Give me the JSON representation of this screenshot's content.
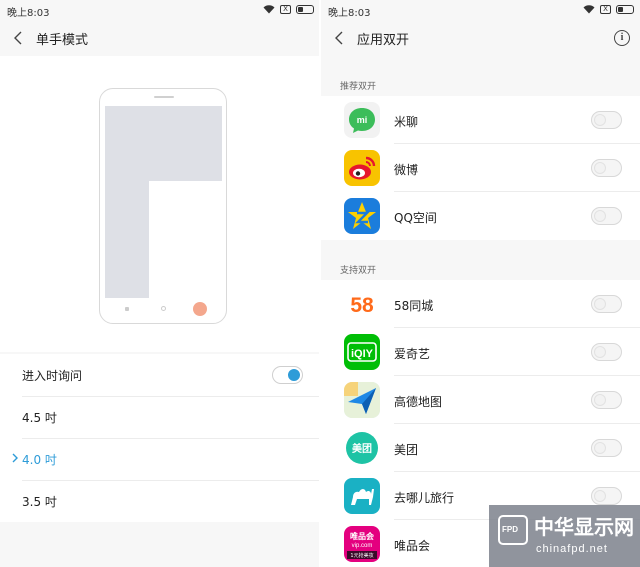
{
  "left": {
    "status": {
      "time": "晚上8:03",
      "sim_label": "X"
    },
    "header": {
      "title": "单手模式"
    },
    "enter_prompt": {
      "label": "进入时询问",
      "enabled": true
    },
    "sizes": [
      {
        "label": "4.5 吋",
        "selected": false
      },
      {
        "label": "4.0 吋",
        "selected": true
      },
      {
        "label": "3.5 吋",
        "selected": false
      }
    ]
  },
  "right": {
    "status": {
      "time": "晚上8:03",
      "sim_label": "X"
    },
    "header": {
      "title": "应用双开",
      "info_icon": "i"
    },
    "recommended": {
      "label": "推荐双开",
      "apps": [
        {
          "name": "米聊",
          "icon": "miliao-icon",
          "icon_text": "mi",
          "enabled": false
        },
        {
          "name": "微博",
          "icon": "weibo-icon",
          "enabled": false
        },
        {
          "name": "QQ空间",
          "icon": "qzone-icon",
          "enabled": false
        }
      ]
    },
    "supported": {
      "label": "支持双开",
      "apps": [
        {
          "name": "58同城",
          "icon": "58-icon",
          "icon_text": "58",
          "enabled": false
        },
        {
          "name": "爱奇艺",
          "icon": "iqiyi-icon",
          "icon_text": "iQIY",
          "enabled": false
        },
        {
          "name": "高德地图",
          "icon": "amap-icon",
          "enabled": false
        },
        {
          "name": "美团",
          "icon": "meituan-icon",
          "icon_text": "美团",
          "enabled": false
        },
        {
          "name": "去哪儿旅行",
          "icon": "qunar-icon",
          "enabled": false
        },
        {
          "name": "唯品会",
          "icon": "vip-icon",
          "icon_text": [
            "唯品会",
            "vip.com",
            "1元抢美妆"
          ],
          "enabled": false
        }
      ]
    }
  },
  "watermark": {
    "logo": "FPD",
    "name": "中华显示网",
    "url": "chinafpd.net"
  },
  "colors": {
    "accent": "#2e9cd8",
    "phone_screen": "#dee0e6",
    "home_button": "#f4a78d"
  }
}
